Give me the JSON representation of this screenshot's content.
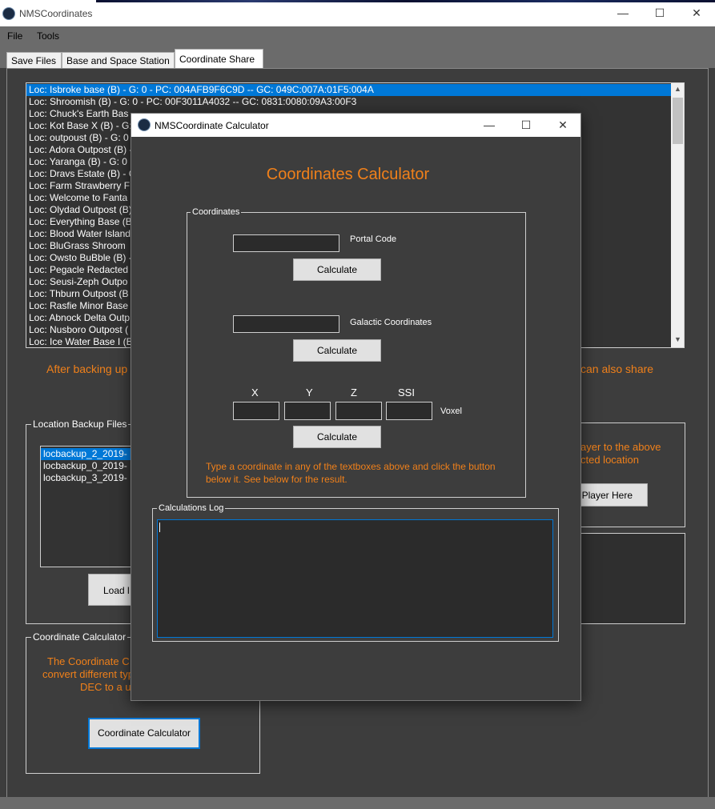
{
  "window": {
    "title": "NMSCoordinates",
    "minimize": "—",
    "maximize": "☐",
    "close": "✕"
  },
  "menu": [
    "File",
    "Tools"
  ],
  "tabs": [
    "Save Files",
    "Base and Space Station",
    "Coordinate Share"
  ],
  "locations": [
    "Loc: Isbroke base (B) - G: 0 - PC: 004AFB9F6C9D -- GC: 049C:007A:01F5:004A",
    "Loc: Shroomish (B) - G: 0 - PC: 00F3011A4032 -- GC: 0831:0080:09A3:00F3",
    "Loc: Chuck's Earth Bas",
    "Loc: Kot Base X (B) - G:",
    "Loc: outpoust (B) - G: 0",
    "Loc: Adora Outpost (B) -",
    "Loc: Yaranga (B) - G: 0",
    "Loc: Dravs Estate (B) - G",
    "Loc: Farm Strawberry F",
    "Loc: Welcome to Fanta",
    "Loc: Olydad Outpost (B)",
    "Loc: Everything Base (B",
    "Loc: Blood Water Island",
    "Loc: BluGrass Shroom",
    "Loc: Owsto BuBble (B) -",
    "Loc: Pegacle Redacted",
    "Loc: Seusi-Zeph Outpo",
    "Loc: Thburn Outpost (B",
    "Loc: Rasfie Minor Base",
    "Loc: Abnock Delta Outp",
    "Loc: Nusboro Outpost (",
    "Loc: Ice Water Base I (B"
  ],
  "info_left": "After backing up",
  "info_right": "can also share",
  "backup": {
    "group_label": "Location Backup Files",
    "files": [
      "locbackup_2_2019-",
      "locbackup_0_2019-",
      "locbackup_3_2019-"
    ],
    "load_label": "Load l"
  },
  "move_player": {
    "text_line1": "ayer to the above",
    "text_line2": "cted location",
    "button": "Player Here"
  },
  "calc_group": {
    "label": "Coordinate Calculator",
    "line1": "The Coordinate C",
    "line2": "convert different typ",
    "line3": "DEC to a u",
    "button": "Coordinate Calculator"
  },
  "dialog": {
    "title": "NMSCoordinate Calculator",
    "heading": "Coordinates Calculator",
    "coords_group": "Coordinates",
    "portal_label": "Portal Code",
    "galactic_label": "Galactic Coordinates",
    "voxel_labels": [
      "X",
      "Y",
      "Z",
      "SSI"
    ],
    "voxel_label": "Voxel",
    "calculate": "Calculate",
    "hint_line1": "Type a coordinate in any of the textboxes above and click the button",
    "hint_line2": "below it.  See below for the result.",
    "log_group": "Calculations Log"
  }
}
